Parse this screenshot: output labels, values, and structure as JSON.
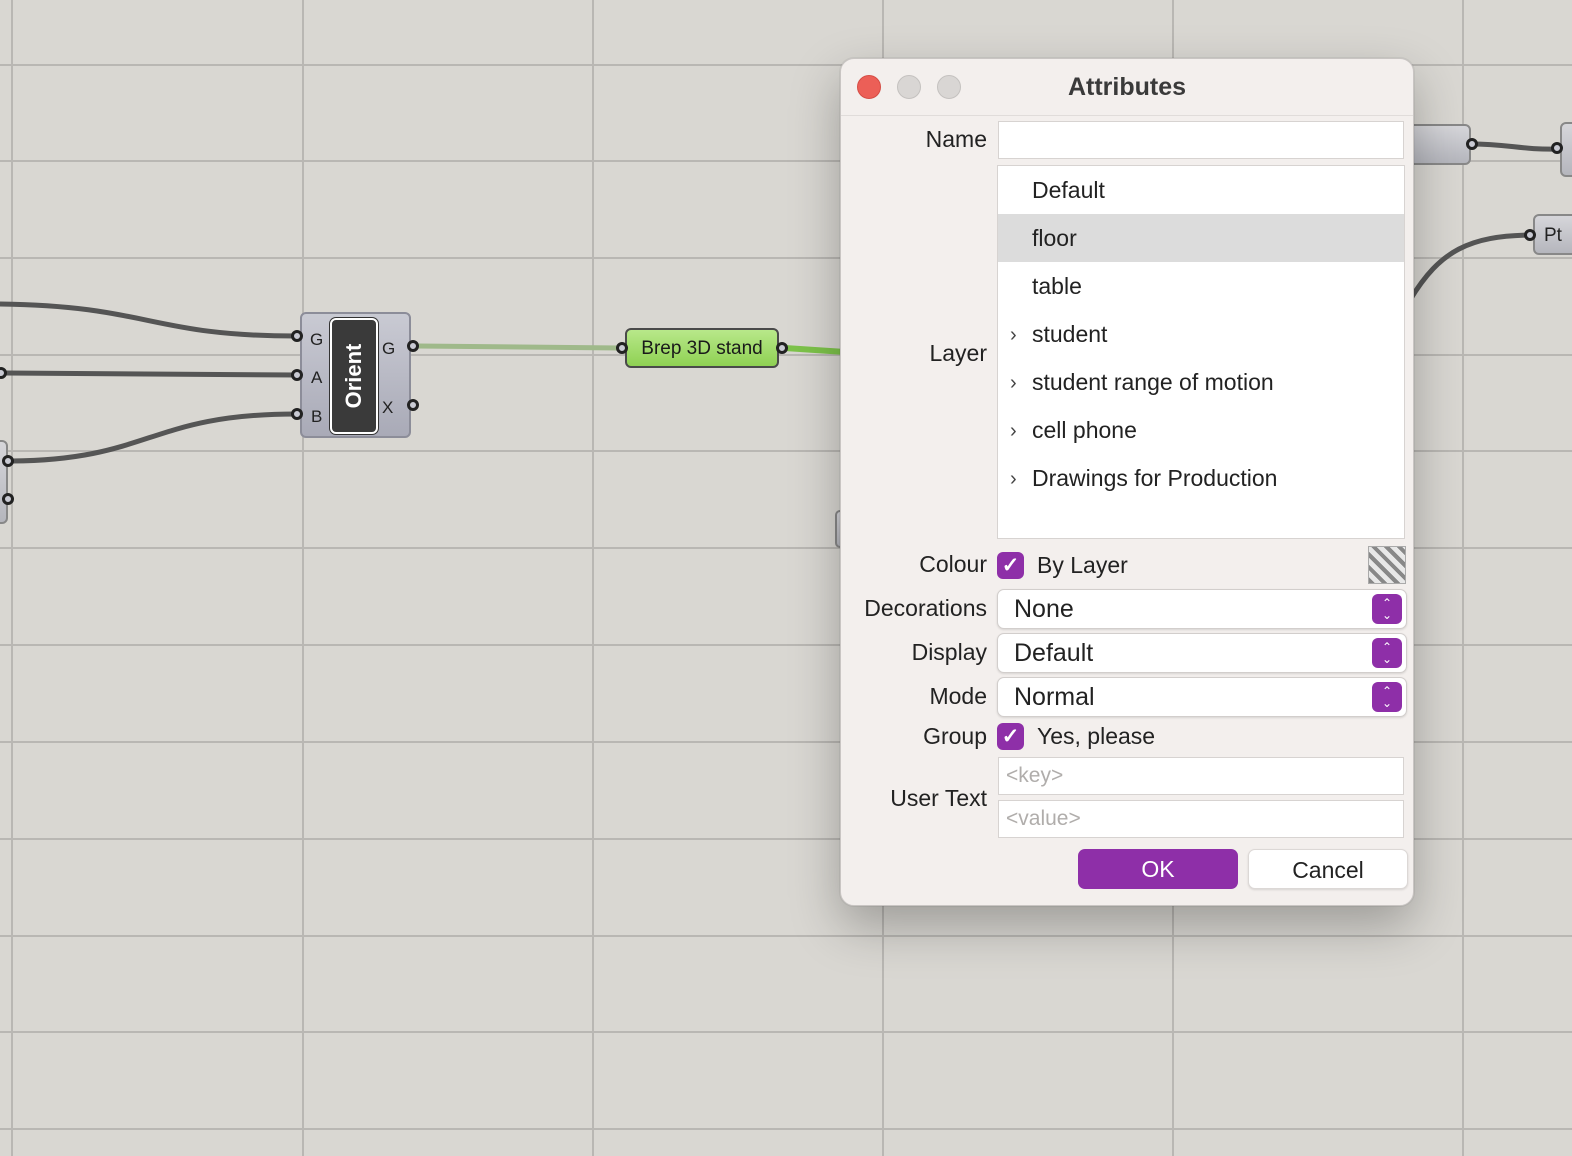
{
  "canvas": {
    "orient_component": {
      "name": "Orient",
      "inputs": [
        "G",
        "A",
        "B"
      ],
      "outputs": [
        "G",
        "X"
      ]
    },
    "panel_label": "Brep 3D stand",
    "side_node_label": "Pt"
  },
  "dialog": {
    "title": "Attributes",
    "name_label": "Name",
    "name_value": "",
    "layer_label": "Layer",
    "layers": [
      {
        "label": "Default",
        "expandable": false,
        "selected": false
      },
      {
        "label": "floor",
        "expandable": false,
        "selected": true
      },
      {
        "label": "table",
        "expandable": false,
        "selected": false
      },
      {
        "label": "student",
        "expandable": true,
        "selected": false
      },
      {
        "label": "student range of motion",
        "expandable": true,
        "selected": false
      },
      {
        "label": "cell phone",
        "expandable": true,
        "selected": false
      },
      {
        "label": "Drawings for Production",
        "expandable": true,
        "selected": false
      }
    ],
    "colour_label": "Colour",
    "colour_checkbox_label": "By Layer",
    "decorations_label": "Decorations",
    "decorations_value": "None",
    "display_label": "Display",
    "display_value": "Default",
    "mode_label": "Mode",
    "mode_value": "Normal",
    "group_label": "Group",
    "group_checkbox_label": "Yes, please",
    "user_text_label": "User Text",
    "key_placeholder": "<key>",
    "value_placeholder": "<value>",
    "ok_label": "OK",
    "cancel_label": "Cancel",
    "accent_color": "#8e2fa8"
  }
}
